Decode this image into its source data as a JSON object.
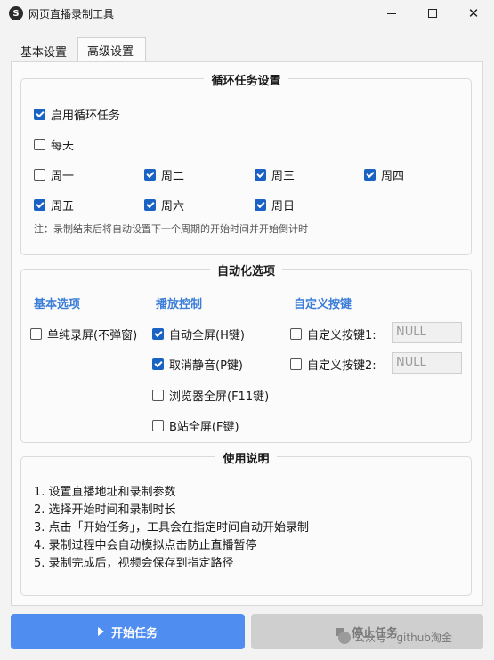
{
  "window": {
    "title": "网页直播录制工具",
    "icon": "app-logo-icon"
  },
  "tabs": [
    {
      "label": "基本设置",
      "active": false
    },
    {
      "label": "高级设置",
      "active": true
    }
  ],
  "loop": {
    "title": "循环任务设置",
    "enable": {
      "label": "启用循环任务",
      "checked": true
    },
    "daily": {
      "label": "每天",
      "checked": false
    },
    "days": [
      {
        "label": "周一",
        "checked": false
      },
      {
        "label": "周二",
        "checked": true
      },
      {
        "label": "周三",
        "checked": true
      },
      {
        "label": "周四",
        "checked": true
      },
      {
        "label": "周五",
        "checked": true
      },
      {
        "label": "周六",
        "checked": true
      },
      {
        "label": "周日",
        "checked": true
      }
    ],
    "note": "注：录制结束后将自动设置下一个周期的开始时间并开始倒计时"
  },
  "auto": {
    "title": "自动化选项",
    "headers": {
      "basic": "基本选项",
      "playback": "播放控制",
      "custom": "自定义按键"
    },
    "pure_record": {
      "label": "单纯录屏(不弹窗)",
      "checked": false
    },
    "playback": [
      {
        "label": "自动全屏(H键)",
        "checked": true
      },
      {
        "label": "取消静音(P键)",
        "checked": true
      },
      {
        "label": "浏览器全屏(F11键)",
        "checked": false
      },
      {
        "label": "B站全屏(F键)",
        "checked": false
      }
    ],
    "custom": [
      {
        "label": "自定义按键1:",
        "checked": false,
        "value": "NULL"
      },
      {
        "label": "自定义按键2:",
        "checked": false,
        "value": "NULL"
      }
    ]
  },
  "usage": {
    "title": "使用说明",
    "items": [
      "1. 设置直播地址和录制参数",
      "2. 选择开始时间和录制时长",
      "3. 点击「开始任务」，工具会在指定时间自动开始录制",
      "4. 录制过程中会自动模拟点击防止直播暂停",
      "5. 录制完成后，视频会保存到指定路径"
    ]
  },
  "buttons": {
    "start": "开始任务",
    "stop": "停止任务"
  },
  "watermark": "公众号 · github淘金",
  "colors": {
    "primary": "#4f8ef0",
    "checkbox": "#1a63c4",
    "header": "#3b7dd8"
  }
}
